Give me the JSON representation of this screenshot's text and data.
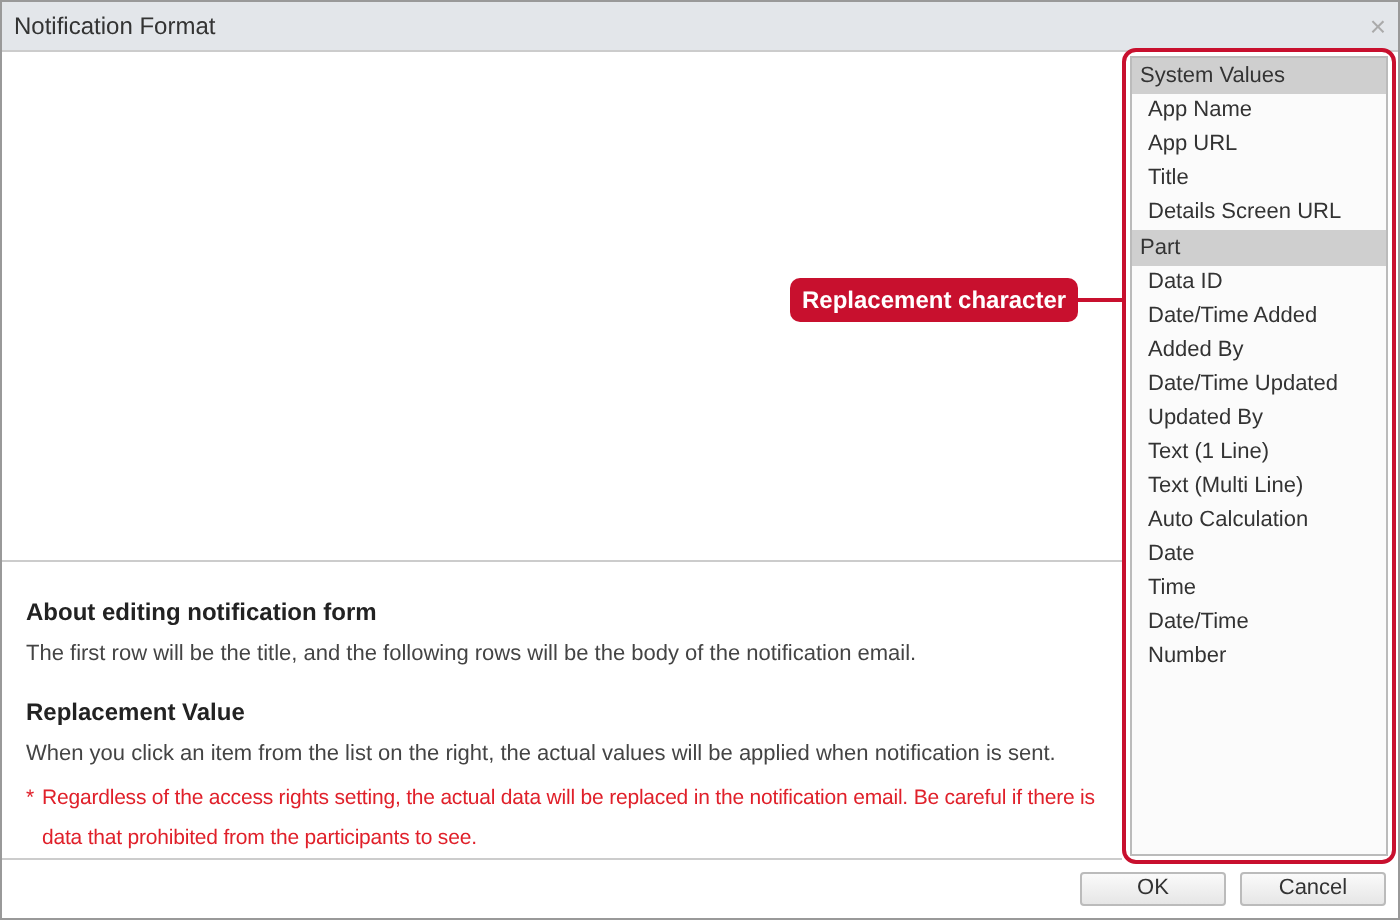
{
  "window": {
    "title": "Notification Format",
    "close": "×"
  },
  "info": [
    {
      "kind": "heading",
      "text": "About editing notification form"
    },
    {
      "kind": "body",
      "text": "The first row will be the title, and the following rows will be the body of the notification email."
    },
    {
      "kind": "heading",
      "text": "Replacement Value"
    },
    {
      "kind": "body",
      "text": "When you click an item from the list on the right, the actual values will be applied when notification is sent."
    },
    {
      "kind": "warning",
      "mark": "*",
      "text": "Regardless of the access rights setting, the actual data will be replaced in the notification email. Be careful if there is data that prohibited from the participants to see."
    }
  ],
  "list": [
    {
      "kind": "header",
      "label": "System Values"
    },
    {
      "kind": "item",
      "label": "App Name"
    },
    {
      "kind": "item",
      "label": "App URL"
    },
    {
      "kind": "item",
      "label": "Title"
    },
    {
      "kind": "item",
      "label": "Details Screen URL"
    },
    {
      "kind": "header",
      "label": "Part"
    },
    {
      "kind": "item",
      "label": "Data ID"
    },
    {
      "kind": "item",
      "label": "Date/Time Added"
    },
    {
      "kind": "item",
      "label": "Added By"
    },
    {
      "kind": "item",
      "label": "Date/Time Updated"
    },
    {
      "kind": "item",
      "label": "Updated By"
    },
    {
      "kind": "item",
      "label": "Text (1 Line)"
    },
    {
      "kind": "item",
      "label": "Text (Multi Line)"
    },
    {
      "kind": "item",
      "label": "Auto Calculation"
    },
    {
      "kind": "item",
      "label": "Date"
    },
    {
      "kind": "item",
      "label": "Time"
    },
    {
      "kind": "item",
      "label": "Date/Time"
    },
    {
      "kind": "item",
      "label": "Number"
    }
  ],
  "annotation": {
    "label": "Replacement character"
  },
  "buttons": [
    "OK",
    "Cancel"
  ]
}
